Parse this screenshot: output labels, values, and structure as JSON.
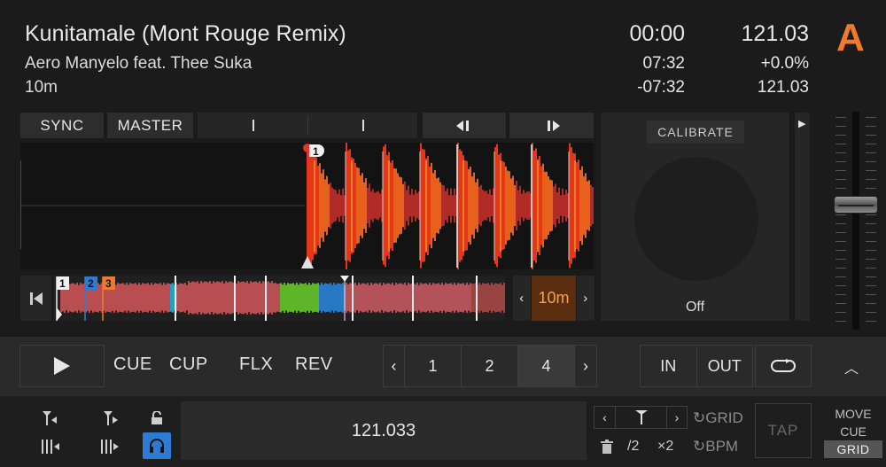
{
  "deck": {
    "letter": "A",
    "accent": "#f07a2c",
    "title": "Kunitamale (Mont Rouge Remix)",
    "artist": "Aero Manyelo feat. Thee Suka",
    "key": "10m",
    "time_elapsed": "00:00",
    "time_total": "07:32",
    "time_remaining": "-07:32",
    "bpm": "121.03",
    "pitch": "+0.0%",
    "bpm_original": "121.03"
  },
  "top_buttons": {
    "sync": "SYNC",
    "master": "MASTER",
    "jump_back_icon": "jump-back-icon",
    "jump_forward_icon": "jump-forward-icon"
  },
  "waveform": {
    "cue_marker": "1",
    "playhead_color": "#e0342a"
  },
  "overview": {
    "cue_markers": [
      "1",
      "2",
      "3"
    ],
    "cue_colors": [
      "#f0f0f0",
      "#2c7cd4",
      "#f07a2c"
    ],
    "loop_size": "10m"
  },
  "platter": {
    "calibrate": "CALIBRATE",
    "state": "Off"
  },
  "transport": {
    "cue": "CUE",
    "cup": "CUP",
    "flx": "FLX",
    "rev": "REV",
    "pages": [
      "1",
      "2",
      "4"
    ],
    "selected_page": "4",
    "loop_in": "IN",
    "loop_out": "OUT"
  },
  "bottom": {
    "display_value": "121.033",
    "grid_label": "GRID",
    "bpm_label": "BPM",
    "half": "/2",
    "double": "×2",
    "tap": "TAP",
    "move_label": "MOVE",
    "cue_label": "CUE",
    "grid_button": "GRID"
  }
}
